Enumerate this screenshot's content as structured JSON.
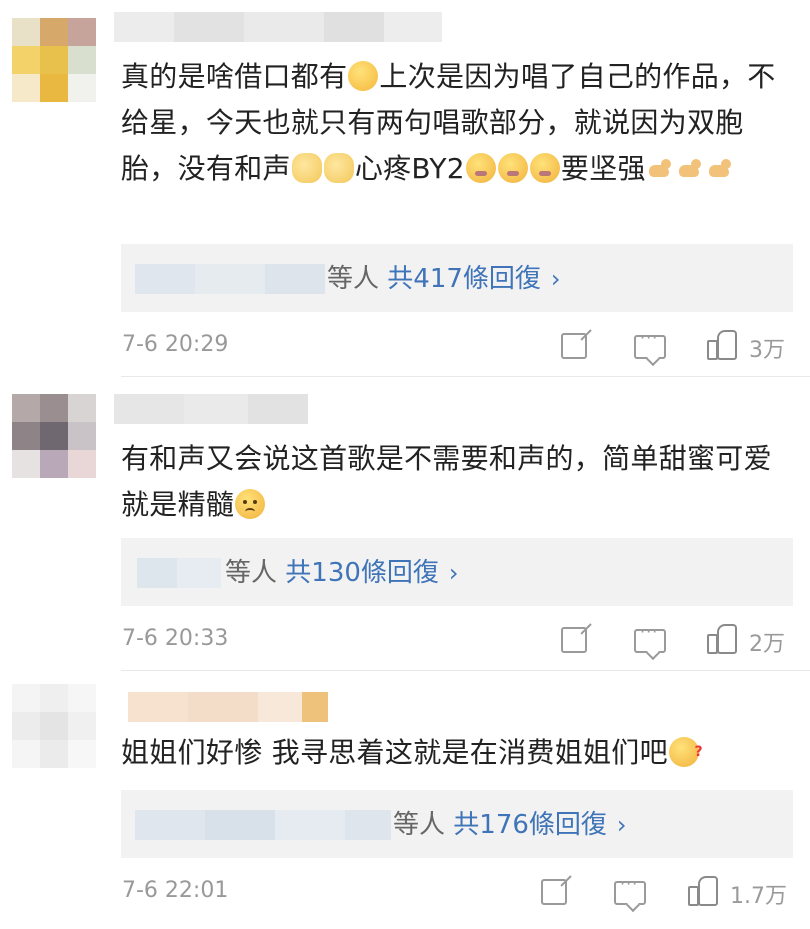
{
  "comments": [
    {
      "text_parts": [
        "真的是啥借口都有",
        "上次是因为唱了自己的作品，不给星，今天也就只有两句唱歌部分，就说因为双胞胎，没有和声",
        "心疼BY2",
        "要坚强"
      ],
      "reply": {
        "suffix": "等人",
        "count_text": "共417條回復",
        "chevron": "›"
      },
      "time": "7-6 20:29",
      "likes": "3万"
    },
    {
      "text_parts": [
        "有和声又会说这首歌是不需要和声的，简单甜蜜可爱就是精髓"
      ],
      "reply": {
        "suffix": "等人",
        "count_text": "共130條回復",
        "chevron": "›"
      },
      "time": "7-6 20:33",
      "likes": "2万"
    },
    {
      "text_parts": [
        "姐姐们好惨 我寻思着这就是在消费姐姐们吧"
      ],
      "reply": {
        "suffix": "等人",
        "count_text": "共176條回復",
        "chevron": "›"
      },
      "time": "7-6 22:01",
      "likes": "1.7万"
    }
  ],
  "icons": {
    "share": "share-icon",
    "comment": "comment-icon",
    "like": "thumbs-up-icon",
    "reply_chevron": "chevron-right-icon"
  },
  "colors": {
    "link": "#3f74b8",
    "meta": "#999999",
    "reply_bg": "#f2f2f2"
  }
}
